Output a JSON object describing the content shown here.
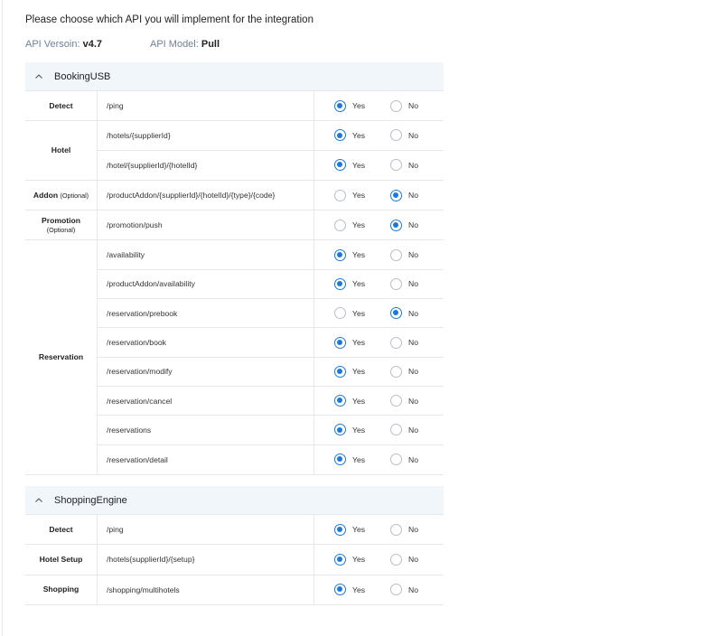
{
  "intro": "Please choose which API  you will implement for the integration",
  "meta": {
    "version_label": "API Versoin:",
    "version_value": "v4.7",
    "model_label": "API Model:",
    "model_value": "Pull"
  },
  "option_labels": {
    "yes": "Yes",
    "no": "No"
  },
  "sections": [
    {
      "title": "BookingUSB",
      "groups": [
        {
          "name": "Detect",
          "rows": [
            {
              "endpoint": "/ping",
              "selected": "yes"
            }
          ]
        },
        {
          "name": "Hotel",
          "rows": [
            {
              "endpoint": "/hotels/{supplierId}",
              "selected": "yes"
            },
            {
              "endpoint": "/hotel/{supplierId}/{hotelId}",
              "selected": "yes"
            }
          ]
        },
        {
          "name": "Addon",
          "optional": "(Optional)",
          "optional_inline": true,
          "rows": [
            {
              "endpoint": "/productAddon/{supplierId}/{hotelId}/{type}/{code}",
              "selected": "no"
            }
          ]
        },
        {
          "name": "Promotion",
          "optional": "(Optional)",
          "optional_inline": false,
          "rows": [
            {
              "endpoint": "/promotion/push",
              "selected": "no"
            }
          ]
        },
        {
          "name": "Reservation",
          "rows": [
            {
              "endpoint": "/availability",
              "selected": "yes"
            },
            {
              "endpoint": "/productAddon/availability",
              "selected": "yes"
            },
            {
              "endpoint": "/reservation/prebook",
              "selected": "no"
            },
            {
              "endpoint": "/reservation/book",
              "selected": "yes"
            },
            {
              "endpoint": "/reservation/modify",
              "selected": "yes"
            },
            {
              "endpoint": "/reservation/cancel",
              "selected": "yes"
            },
            {
              "endpoint": "/reservations",
              "selected": "yes"
            },
            {
              "endpoint": "/reservation/detail",
              "selected": "yes"
            }
          ]
        }
      ]
    },
    {
      "title": "ShoppingEngine",
      "groups": [
        {
          "name": "Detect",
          "rows": [
            {
              "endpoint": "/ping",
              "selected": "yes"
            }
          ]
        },
        {
          "name": "Hotel Setup",
          "rows": [
            {
              "endpoint": "/hotels{supplierId}/{setup}",
              "selected": "yes"
            }
          ]
        },
        {
          "name": "Shopping",
          "rows": [
            {
              "endpoint": "/shopping/multihotels",
              "selected": "yes"
            }
          ]
        }
      ]
    }
  ],
  "colors": {
    "accent": "#1e79d6",
    "header_bg": "#f1f6fb",
    "label_muted": "#6f8196"
  },
  "icons": {
    "collapse": "chevron-up-icon"
  }
}
